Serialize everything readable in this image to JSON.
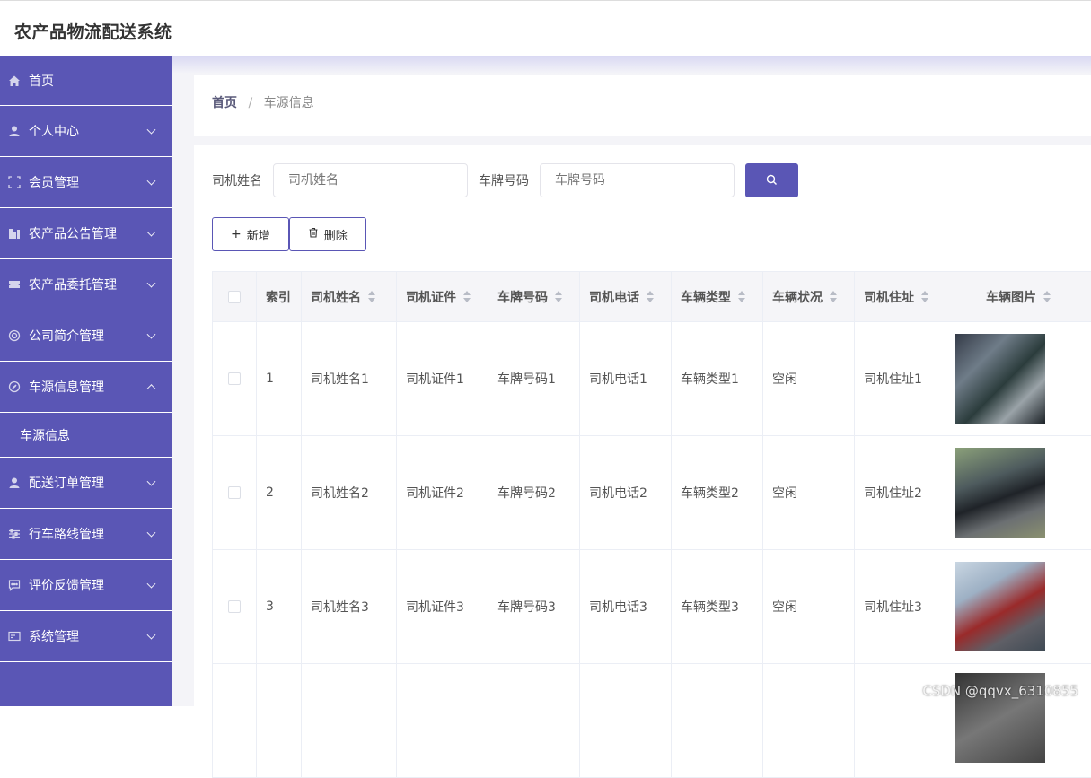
{
  "app": {
    "title": "农产品物流配送系统"
  },
  "sidebar": {
    "items": [
      {
        "label": "首页",
        "icon": "home-icon",
        "chevron": "none"
      },
      {
        "label": "个人中心",
        "icon": "user-icon",
        "chevron": "down"
      },
      {
        "label": "会员管理",
        "icon": "frame-icon",
        "chevron": "down"
      },
      {
        "label": "农产品公告管理",
        "icon": "building-icon",
        "chevron": "down"
      },
      {
        "label": "农产品委托管理",
        "icon": "ticket-icon",
        "chevron": "down"
      },
      {
        "label": "公司简介管理",
        "icon": "circle-icon",
        "chevron": "down"
      },
      {
        "label": "车源信息管理",
        "icon": "compass-icon",
        "chevron": "up"
      },
      {
        "label": "配送订单管理",
        "icon": "user-icon",
        "chevron": "down"
      },
      {
        "label": "行车路线管理",
        "icon": "sliders-icon",
        "chevron": "down"
      },
      {
        "label": "评价反馈管理",
        "icon": "message-icon",
        "chevron": "down"
      },
      {
        "label": "系统管理",
        "icon": "card-icon",
        "chevron": "down"
      }
    ],
    "submenu": {
      "label": "车源信息"
    }
  },
  "breadcrumb": {
    "home": "首页",
    "separator": "/",
    "current": "车源信息"
  },
  "search": {
    "driver_label": "司机姓名",
    "driver_placeholder": "司机姓名",
    "plate_label": "车牌号码",
    "plate_placeholder": "车牌号码"
  },
  "actions": {
    "add": "新增",
    "delete": "删除"
  },
  "table": {
    "columns": [
      "索引",
      "司机姓名",
      "司机证件",
      "车牌号码",
      "司机电话",
      "车辆类型",
      "车辆状况",
      "司机住址",
      "车辆图片"
    ],
    "rows": [
      {
        "index": "1",
        "name": "司机姓名1",
        "license": "司机证件1",
        "plate": "车牌号码1",
        "phone": "司机电话1",
        "type": "车辆类型1",
        "status": "空闲",
        "address": "司机住址1"
      },
      {
        "index": "2",
        "name": "司机姓名2",
        "license": "司机证件2",
        "plate": "车牌号码2",
        "phone": "司机电话2",
        "type": "车辆类型2",
        "status": "空闲",
        "address": "司机住址2"
      },
      {
        "index": "3",
        "name": "司机姓名3",
        "license": "司机证件3",
        "plate": "车牌号码3",
        "phone": "司机电话3",
        "type": "车辆类型3",
        "status": "空闲",
        "address": "司机住址3"
      }
    ]
  },
  "watermark": "CSDN @qqvx_6310855",
  "colors": {
    "accent": "#5a56b5",
    "sidebar_bg": "#5a56b5",
    "page_bg": "#f4f4f8"
  }
}
